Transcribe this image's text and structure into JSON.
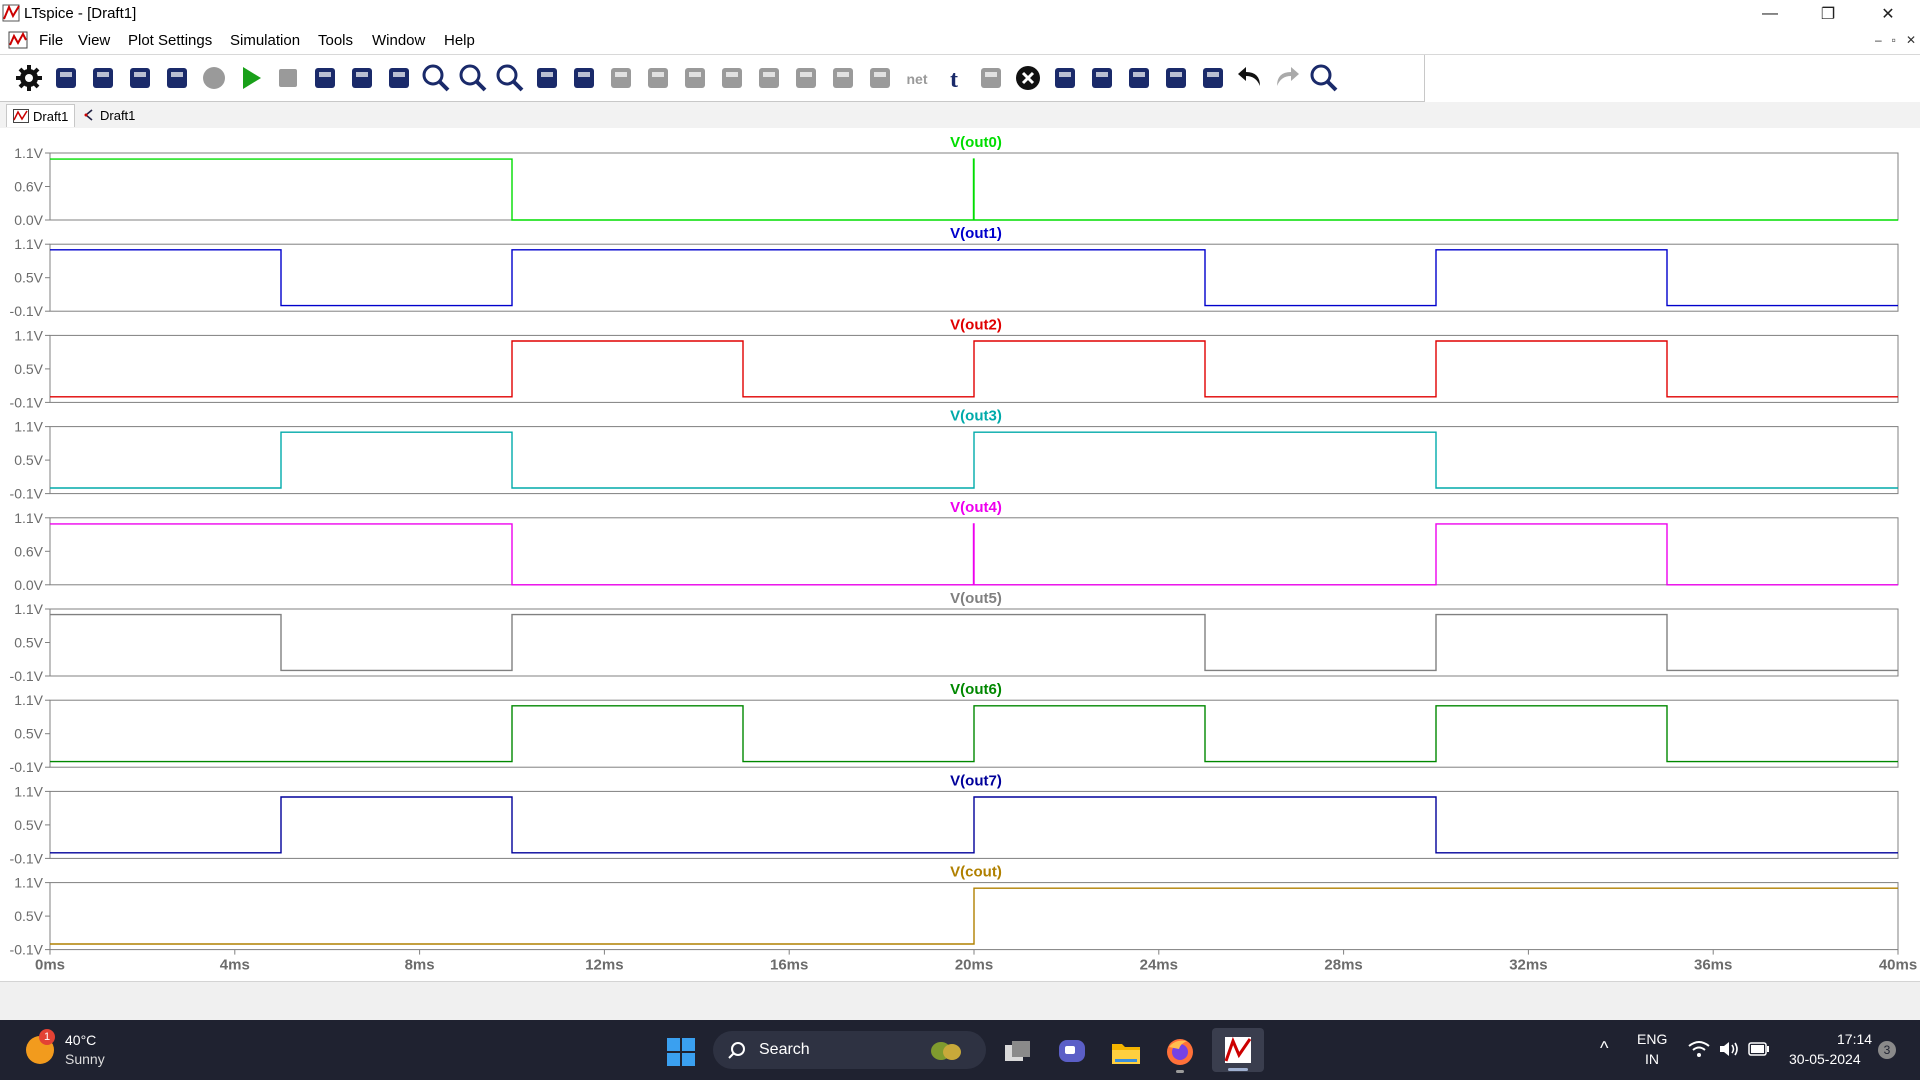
{
  "window": {
    "title": "LTspice - [Draft1]",
    "controls": {
      "minimize": "—",
      "restore": "❐",
      "close": "✕"
    }
  },
  "menu": {
    "items": [
      "File",
      "View",
      "Plot Settings",
      "Simulation",
      "Tools",
      "Window",
      "Help"
    ],
    "mdi_controls": [
      "–",
      "▫",
      "✕"
    ]
  },
  "toolbar": {
    "buttons": [
      "settings-icon",
      "new-schematic-icon",
      "open-icon",
      "save-icon",
      "print-icon",
      "halt-icon",
      "run-icon",
      "stop-icon",
      "tile-vertical-icon",
      "tile-horizontal-icon",
      "cascade-icon",
      "zoom-in-icon",
      "zoom-out-icon",
      "zoom-fit-icon",
      "autorange-icon",
      "add-trace-icon",
      "wire-icon",
      "ground-icon",
      "label-icon",
      "resistor-icon",
      "capacitor-icon",
      "inductor-icon",
      "diode-icon",
      "component-icon",
      "net-icon",
      "text-icon",
      "spice-directive-icon",
      "delete-icon",
      "move-icon",
      "drag-icon",
      "rotate-icon",
      "mirror-icon",
      "draw-icon",
      "undo-icon",
      "redo-icon",
      "find-icon"
    ]
  },
  "tabs": [
    {
      "label": "Draft1",
      "icon": "waveform-icon",
      "active": true
    },
    {
      "label": "Draft1",
      "icon": "schematic-icon",
      "active": false
    }
  ],
  "colors": {
    "out0": "#00dd00",
    "out1": "#0000cc",
    "out2": "#e00000",
    "out3": "#00aaaa",
    "out4": "#ee00ee",
    "out5": "#808080",
    "out6": "#008800",
    "out7": "#00009a",
    "cout": "#b08000",
    "axis": "#808080",
    "text": "#6c6c6c"
  },
  "chart_data": {
    "type": "line",
    "x_unit": "ms",
    "xlim": [
      0,
      40
    ],
    "x_ticks": [
      "0ms",
      "4ms",
      "8ms",
      "12ms",
      "16ms",
      "20ms",
      "24ms",
      "28ms",
      "32ms",
      "36ms",
      "40ms"
    ],
    "series": [
      {
        "name": "V(out0)",
        "color": "#00dd00",
        "ylim": [
          0,
          1.1
        ],
        "y_ticks": [
          "1.1V",
          "0.6V",
          "0.0V"
        ],
        "x": [
          0,
          10,
          10,
          19.99,
          19.99,
          20,
          20,
          40
        ],
        "y": [
          1.0,
          1.0,
          0,
          0,
          1.0,
          1.0,
          0,
          0
        ]
      },
      {
        "name": "V(out1)",
        "color": "#0000cc",
        "ylim": [
          -0.1,
          1.1
        ],
        "y_ticks": [
          "1.1V",
          "0.5V",
          "-0.1V"
        ],
        "x": [
          0,
          5,
          5,
          10,
          10,
          25,
          25,
          30,
          30,
          35,
          35,
          40
        ],
        "y": [
          1.0,
          1.0,
          0,
          0,
          1.0,
          1.0,
          0,
          0,
          1.0,
          1.0,
          0,
          0
        ]
      },
      {
        "name": "V(out2)",
        "color": "#e00000",
        "ylim": [
          -0.1,
          1.1
        ],
        "y_ticks": [
          "1.1V",
          "0.5V",
          "-0.1V"
        ],
        "x": [
          0,
          10,
          10,
          15,
          15,
          20,
          20,
          25,
          25,
          30,
          30,
          35,
          35,
          40
        ],
        "y": [
          0,
          0,
          1.0,
          1.0,
          0,
          0,
          1.0,
          1.0,
          0,
          0,
          1.0,
          1.0,
          0,
          0
        ]
      },
      {
        "name": "V(out3)",
        "color": "#00aaaa",
        "ylim": [
          -0.1,
          1.1
        ],
        "y_ticks": [
          "1.1V",
          "0.5V",
          "-0.1V"
        ],
        "x": [
          0,
          5,
          5,
          10,
          10,
          20,
          20,
          30,
          30,
          40
        ],
        "y": [
          0,
          0,
          1.0,
          1.0,
          0,
          0,
          1.0,
          1.0,
          0,
          0
        ]
      },
      {
        "name": "V(out4)",
        "color": "#ee00ee",
        "ylim": [
          0,
          1.1
        ],
        "y_ticks": [
          "1.1V",
          "0.6V",
          "0.0V"
        ],
        "x": [
          0,
          10,
          10,
          19.99,
          19.99,
          20,
          20,
          30,
          30,
          35,
          35,
          40
        ],
        "y": [
          1.0,
          1.0,
          0,
          0,
          1.0,
          1.0,
          0,
          0,
          1.0,
          1.0,
          0,
          0
        ]
      },
      {
        "name": "V(out5)",
        "color": "#808080",
        "ylim": [
          -0.1,
          1.1
        ],
        "y_ticks": [
          "1.1V",
          "0.5V",
          "-0.1V"
        ],
        "x": [
          0,
          5,
          5,
          10,
          10,
          25,
          25,
          30,
          30,
          35,
          35,
          40
        ],
        "y": [
          1.0,
          1.0,
          0,
          0,
          1.0,
          1.0,
          0,
          0,
          1.0,
          1.0,
          0,
          0
        ]
      },
      {
        "name": "V(out6)",
        "color": "#008800",
        "ylim": [
          -0.1,
          1.1
        ],
        "y_ticks": [
          "1.1V",
          "0.5V",
          "-0.1V"
        ],
        "x": [
          0,
          10,
          10,
          15,
          15,
          20,
          20,
          25,
          25,
          30,
          30,
          35,
          35,
          40
        ],
        "y": [
          0,
          0,
          1.0,
          1.0,
          0,
          0,
          1.0,
          1.0,
          0,
          0,
          1.0,
          1.0,
          0,
          0
        ]
      },
      {
        "name": "V(out7)",
        "color": "#00009a",
        "ylim": [
          -0.1,
          1.1
        ],
        "y_ticks": [
          "1.1V",
          "0.5V",
          "-0.1V"
        ],
        "x": [
          0,
          5,
          5,
          10,
          10,
          20,
          20,
          30,
          30,
          40
        ],
        "y": [
          0,
          0,
          1.0,
          1.0,
          0,
          0,
          1.0,
          1.0,
          0,
          0
        ]
      },
      {
        "name": "V(cout)",
        "color": "#b08000",
        "ylim": [
          -0.1,
          1.1
        ],
        "y_ticks": [
          "1.1V",
          "0.5V",
          "-0.1V"
        ],
        "x": [
          0,
          20,
          20,
          40
        ],
        "y": [
          0,
          0,
          1.0,
          1.0
        ]
      }
    ]
  },
  "taskbar": {
    "weather": {
      "temp": "40°C",
      "condition": "Sunny",
      "badge": "1"
    },
    "search_label": "Search",
    "tray": {
      "lang": "ENG",
      "region": "IN",
      "time": "17:14",
      "date": "30-05-2024",
      "notifications": "3"
    }
  }
}
